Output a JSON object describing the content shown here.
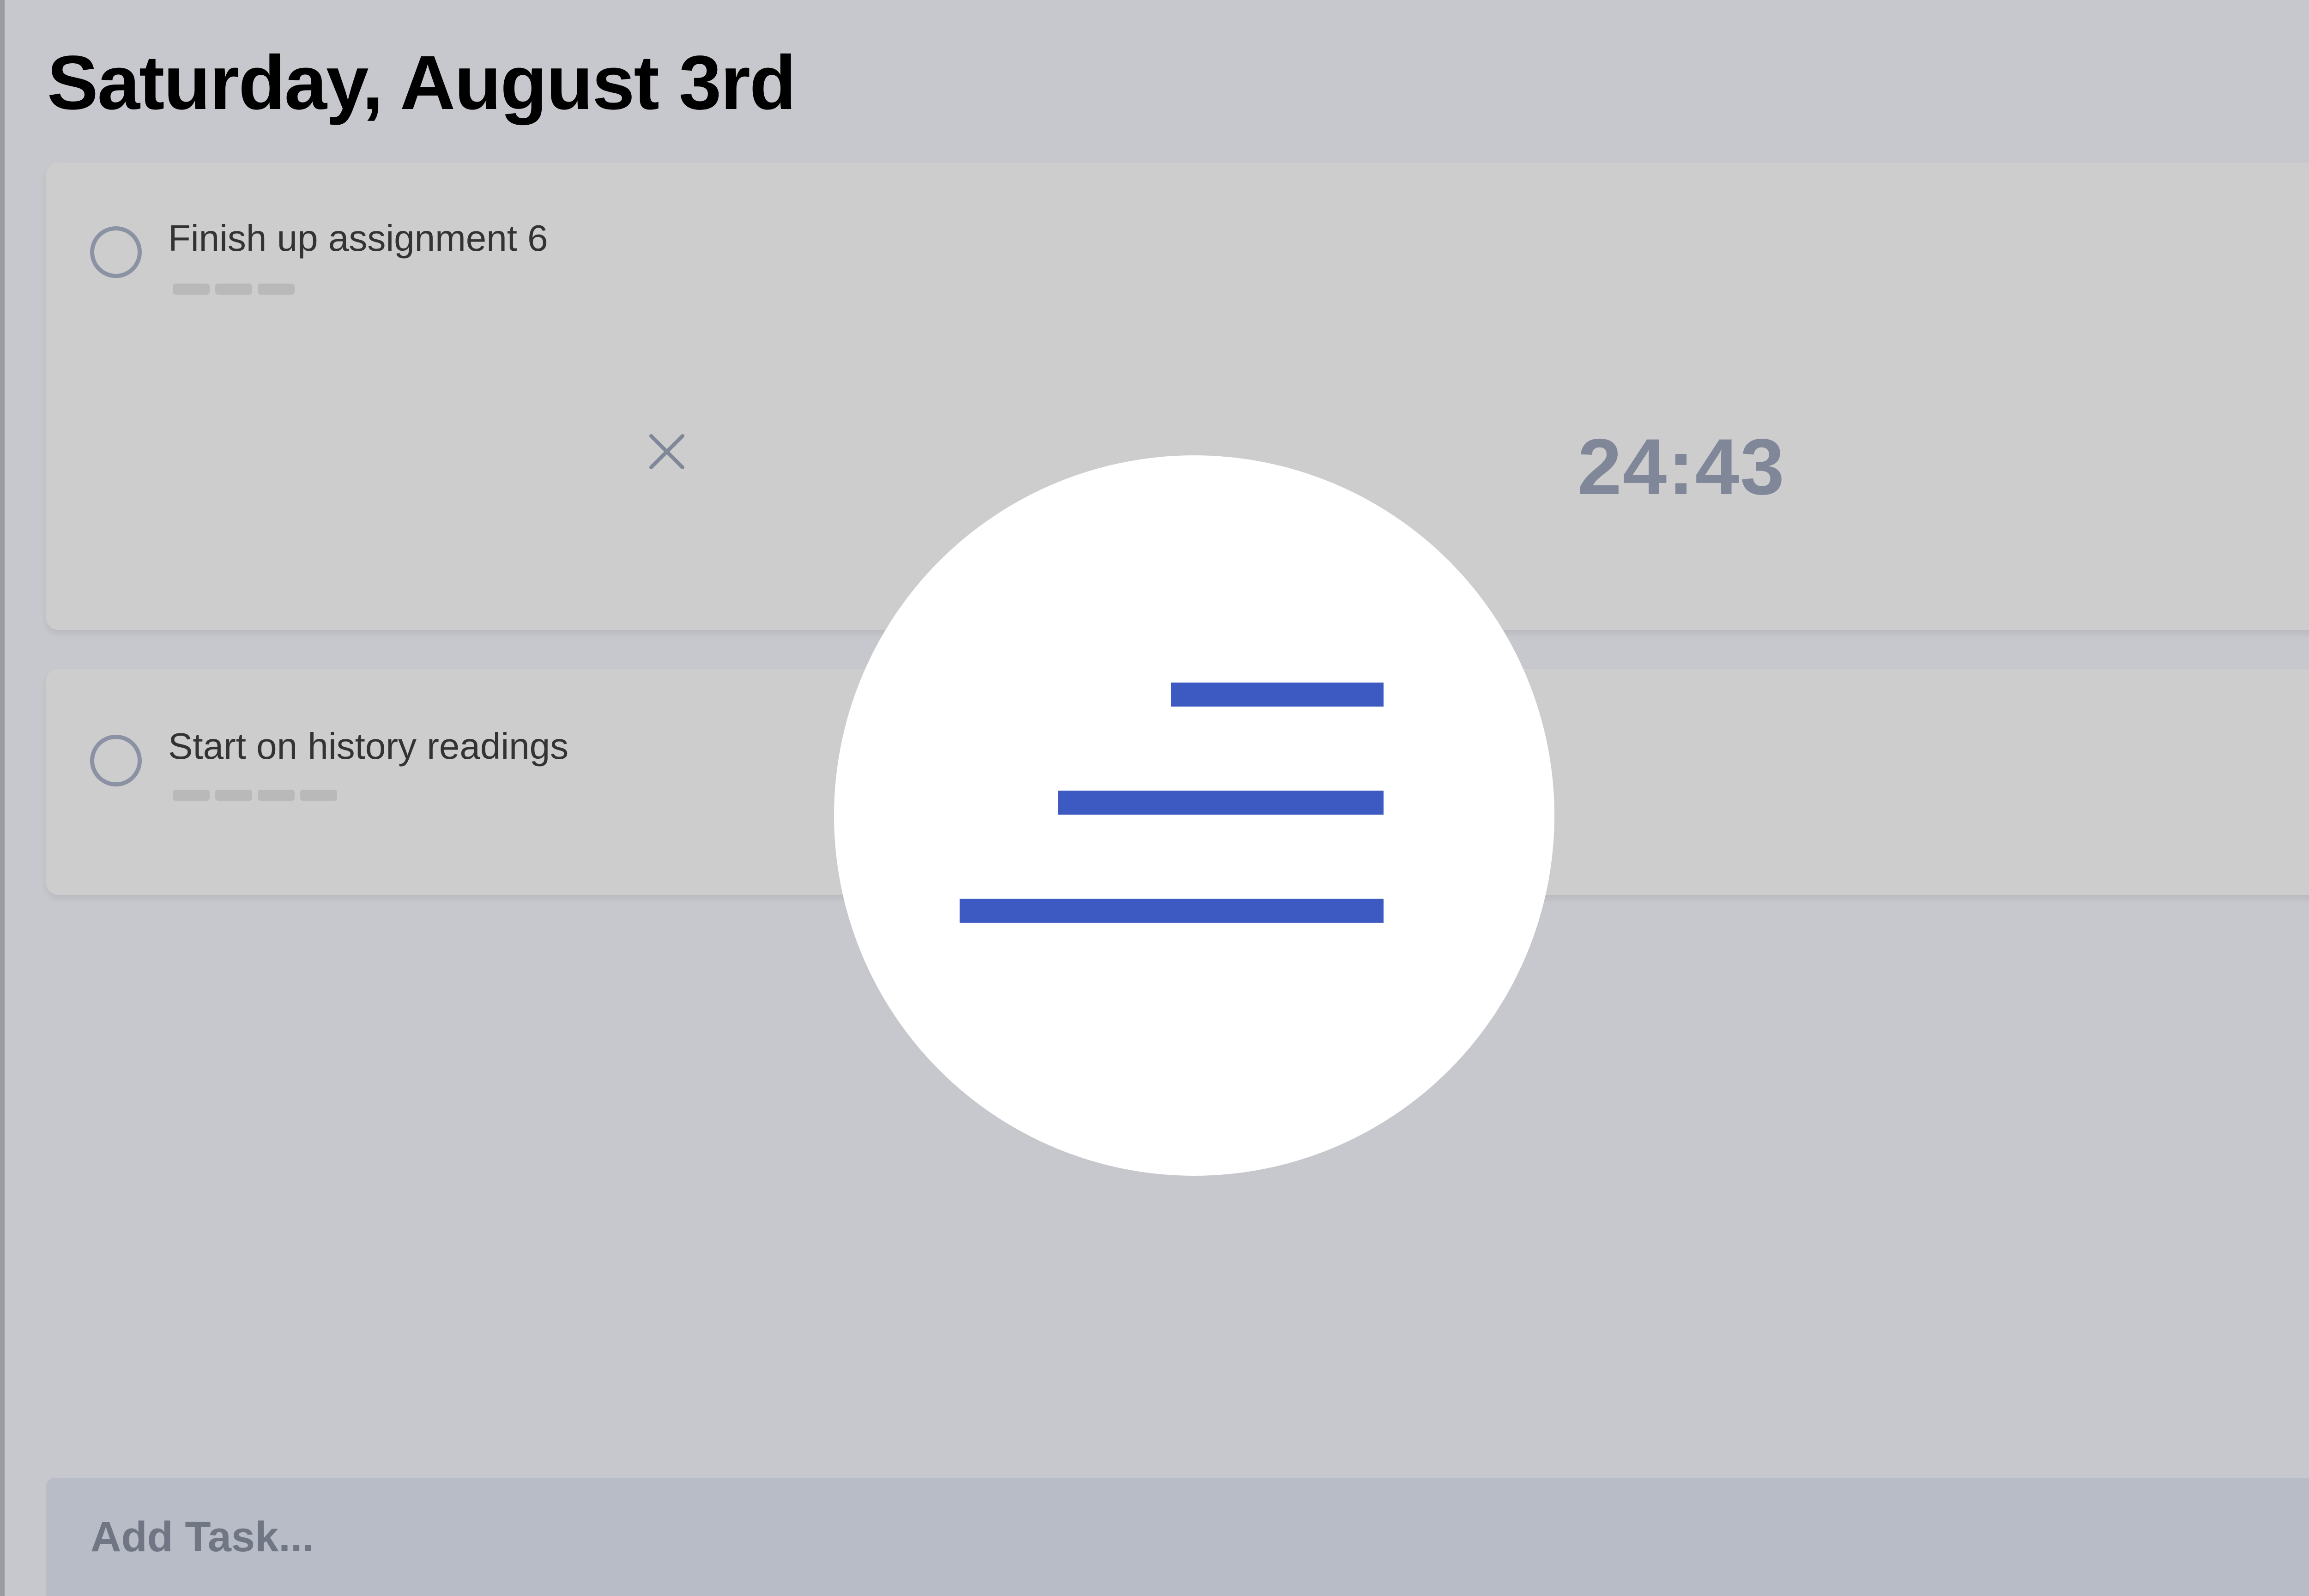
{
  "header": {
    "date_title": "Saturday, August 3rd"
  },
  "tasks": [
    {
      "title": "Finish up assignment 6",
      "priority_dashes": 3,
      "expanded": true,
      "timer": "24:43",
      "close_icon": "close-icon"
    },
    {
      "title": "Start on history readings",
      "priority_dashes": 4,
      "expanded": false
    }
  ],
  "add_task": {
    "placeholder": "Add Task..."
  },
  "fab": {
    "icon": "sort-lines-icon",
    "color": "#3c5ac1"
  },
  "colors": {
    "background": "#c7c8cd",
    "card": "#cdcdcd",
    "checkbox_border": "#8a92a3",
    "timer_text": "#808799",
    "add_task_bar": "#b8bcc6",
    "accent": "#3c5ac1"
  }
}
